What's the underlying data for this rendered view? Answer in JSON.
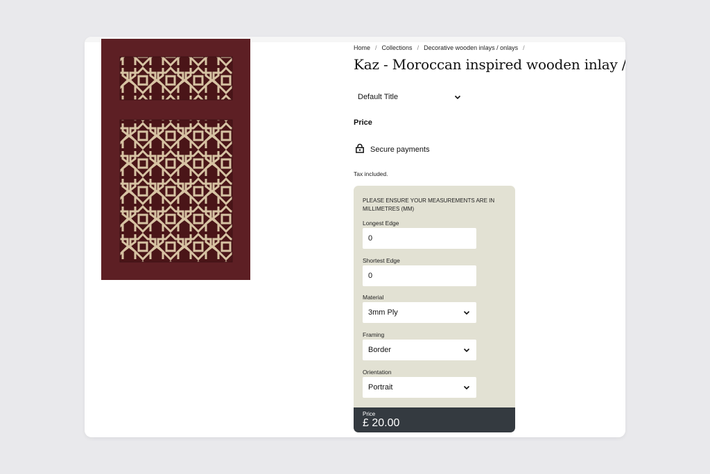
{
  "breadcrumb": {
    "items": [
      "Home",
      "Collections",
      "Decorative wooden inlays / onlays"
    ],
    "separator": "/"
  },
  "product": {
    "title": "Kaz - Moroccan inspired wooden inlay / onlay",
    "image_alt_color": "#5d1f24",
    "pattern_color": "#d7c3a3"
  },
  "variant": {
    "selected": "Default Title",
    "icon": "chevron-down-icon"
  },
  "price_label": "Price",
  "secure": {
    "label": "Secure payments",
    "icon": "lock-icon"
  },
  "tax_note": "Tax included.",
  "calculator": {
    "notice": "PLEASE ENSURE YOUR MEASUREMENTS ARE IN MILLIMETRES (MM)",
    "background": "#e2e1d3",
    "fields": {
      "longest_edge": {
        "label": "Longest Edge",
        "value": "0"
      },
      "shortest_edge": {
        "label": "Shortest Edge",
        "value": "0"
      },
      "material": {
        "label": "Material",
        "value": "3mm Ply"
      },
      "framing": {
        "label": "Framing",
        "value": "Border"
      },
      "orientation": {
        "label": "Orientation",
        "value": "Portrait"
      }
    },
    "footer": {
      "label": "Price",
      "value": "£ 20.00",
      "background": "#343a40"
    }
  }
}
